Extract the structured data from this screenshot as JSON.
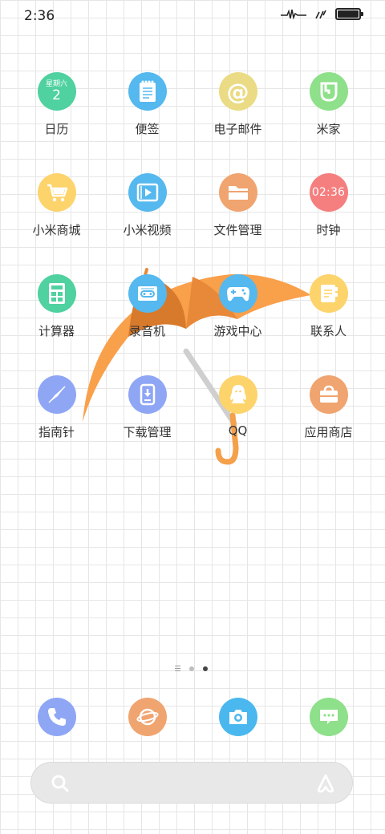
{
  "status_bar": {
    "time": "2:36"
  },
  "apps": [
    {
      "label": "日历",
      "icon": "calendar-icon",
      "color": "#4fd1a0",
      "weekday": "星期六",
      "day": "2"
    },
    {
      "label": "便签",
      "icon": "notes-icon",
      "color": "#55b8ee"
    },
    {
      "label": "电子邮件",
      "icon": "email-icon",
      "color": "#eadb84"
    },
    {
      "label": "米家",
      "icon": "mijia-icon",
      "color": "#8ee08a"
    },
    {
      "label": "小米商城",
      "icon": "shopping-cart-icon",
      "color": "#fdd36b"
    },
    {
      "label": "小米视频",
      "icon": "video-icon",
      "color": "#55b8ee"
    },
    {
      "label": "文件管理",
      "icon": "folder-icon",
      "color": "#f0a46f"
    },
    {
      "label": "时钟",
      "icon": "clock-icon",
      "color": "#f57e7e",
      "clock_time": "02:36"
    },
    {
      "label": "计算器",
      "icon": "calculator-icon",
      "color": "#4fd1a0"
    },
    {
      "label": "录音机",
      "icon": "recorder-icon",
      "color": "#55b8ee"
    },
    {
      "label": "游戏中心",
      "icon": "gamepad-icon",
      "color": "#55b8ee"
    },
    {
      "label": "联系人",
      "icon": "contacts-icon",
      "color": "#fdd36b"
    },
    {
      "label": "指南针",
      "icon": "compass-icon",
      "color": "#8fa6f5"
    },
    {
      "label": "下载管理",
      "icon": "download-icon",
      "color": "#8fa6f5"
    },
    {
      "label": "QQ",
      "icon": "qq-icon",
      "color": "#fdd36b"
    },
    {
      "label": "应用商店",
      "icon": "app-store-icon",
      "color": "#f0a46f"
    }
  ],
  "page_indicator": {
    "pages": 3,
    "current": 3
  },
  "dock": [
    {
      "icon": "phone-icon",
      "color": "#8fa6f5"
    },
    {
      "icon": "browser-icon",
      "color": "#f0a46f"
    },
    {
      "icon": "camera-icon",
      "color": "#4ab8ee"
    },
    {
      "icon": "messages-icon",
      "color": "#8ee08a"
    }
  ],
  "search_bar": {
    "left_icon": "search-icon",
    "right_icon": "assistant-icon"
  }
}
